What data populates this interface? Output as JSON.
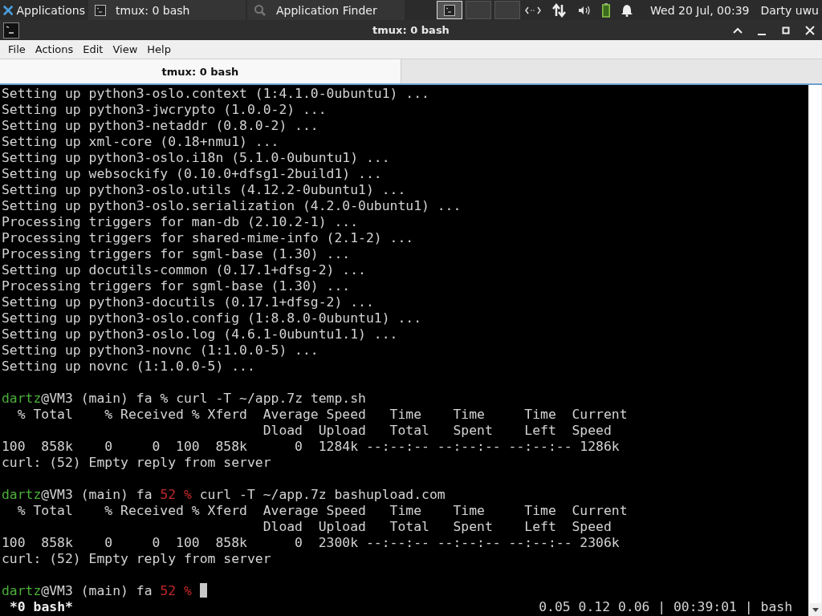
{
  "panel": {
    "apps_label": "Applications",
    "tasks": [
      {
        "label": "tmux: 0 bash",
        "selected": false
      },
      {
        "label": "Application Finder",
        "selected": false
      }
    ],
    "workspaces": [
      {
        "selected": true,
        "has_window": true
      },
      {
        "selected": false,
        "has_window": false
      },
      {
        "selected": false,
        "has_window": false
      }
    ],
    "clock": "Wed 20 Jul, 00:39",
    "user": "Darty uwu"
  },
  "window": {
    "title": "tmux: 0 bash"
  },
  "menu": [
    "File",
    "Actions",
    "Edit",
    "View",
    "Help"
  ],
  "tabs": [
    {
      "label": "tmux: 0 bash",
      "selected": true
    }
  ],
  "terminal": {
    "lines": [
      {
        "kind": "output",
        "text": "Setting up python3-oslo.context (1:4.1.0-0ubuntu1) ..."
      },
      {
        "kind": "output",
        "text": "Setting up python3-jwcrypto (1.0.0-2) ..."
      },
      {
        "kind": "output",
        "text": "Setting up python3-netaddr (0.8.0-2) ..."
      },
      {
        "kind": "output",
        "text": "Setting up xml-core (0.18+nmu1) ..."
      },
      {
        "kind": "output",
        "text": "Setting up python3-oslo.i18n (5.1.0-0ubuntu1) ..."
      },
      {
        "kind": "output",
        "text": "Setting up websockify (0.10.0+dfsg1-2build1) ..."
      },
      {
        "kind": "output",
        "text": "Setting up python3-oslo.utils (4.12.2-0ubuntu1) ..."
      },
      {
        "kind": "output",
        "text": "Setting up python3-oslo.serialization (4.2.0-0ubuntu1) ..."
      },
      {
        "kind": "output",
        "text": "Processing triggers for man-db (2.10.2-1) ..."
      },
      {
        "kind": "output",
        "text": "Processing triggers for shared-mime-info (2.1-2) ..."
      },
      {
        "kind": "output",
        "text": "Processing triggers for sgml-base (1.30) ..."
      },
      {
        "kind": "output",
        "text": "Setting up docutils-common (0.17.1+dfsg-2) ..."
      },
      {
        "kind": "output",
        "text": "Processing triggers for sgml-base (1.30) ..."
      },
      {
        "kind": "output",
        "text": "Setting up python3-docutils (0.17.1+dfsg-2) ..."
      },
      {
        "kind": "output",
        "text": "Setting up python3-oslo.config (1:8.8.0-0ubuntu1) ..."
      },
      {
        "kind": "output",
        "text": "Setting up python3-oslo.log (4.6.1-0ubuntu1.1) ..."
      },
      {
        "kind": "output",
        "text": "Setting up python3-novnc (1:1.0.0-5) ..."
      },
      {
        "kind": "output",
        "text": "Setting up novnc (1:1.0.0-5) ..."
      },
      {
        "kind": "blank"
      },
      {
        "kind": "prompt",
        "user": "dartz",
        "host": "@VM3 (main) fa",
        "symbol": "%",
        "command": "curl -T ~/app.7z temp.sh"
      },
      {
        "kind": "output",
        "text": "  % Total    % Received % Xferd  Average Speed   Time    Time     Time  Current"
      },
      {
        "kind": "output",
        "text": "                                 Dload  Upload   Total   Spent    Left  Speed"
      },
      {
        "kind": "output",
        "text": "100  858k    0     0  100  858k      0  1284k --:--:-- --:--:-- --:--:-- 1286k"
      },
      {
        "kind": "output",
        "text": "curl: (52) Empty reply from server"
      },
      {
        "kind": "blank"
      },
      {
        "kind": "prompt",
        "user": "dartz",
        "host": "@VM3 (main) fa",
        "exit_code": "52",
        "symbol": "%",
        "command": "curl -T ~/app.7z bashupload.com"
      },
      {
        "kind": "output",
        "text": "  % Total    % Received % Xferd  Average Speed   Time    Time     Time  Current"
      },
      {
        "kind": "output",
        "text": "                                 Dload  Upload   Total   Spent    Left  Speed"
      },
      {
        "kind": "output",
        "text": "100  858k    0     0  100  858k      0  2300k --:--:-- --:--:-- --:--:-- 2306k"
      },
      {
        "kind": "output",
        "text": "curl: (52) Empty reply from server"
      },
      {
        "kind": "blank"
      },
      {
        "kind": "prompt",
        "user": "dartz",
        "host": "@VM3 (main) fa",
        "exit_code": "52",
        "symbol": "%",
        "cursor": true
      }
    ],
    "status_bar": {
      "window_list": "*0 bash*",
      "info": "0.05 0.12 0.06 | 00:39:01 | bash"
    }
  }
}
